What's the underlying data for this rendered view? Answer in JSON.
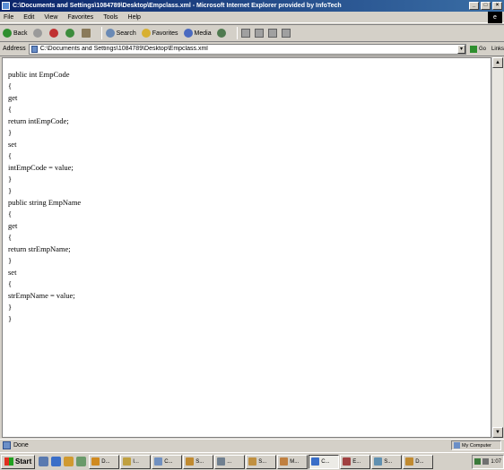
{
  "window": {
    "title": "C:\\Documents and Settings\\1084789\\Desktop\\Empclass.xml - Microsoft Internet Explorer provided by InfoTech"
  },
  "menubar": {
    "items": [
      "File",
      "Edit",
      "View",
      "Favorites",
      "Tools",
      "Help"
    ]
  },
  "toolbar": {
    "back_label": "Back",
    "search_label": "Search",
    "favorites_label": "Favorites",
    "media_label": "Media"
  },
  "address": {
    "label": "Address",
    "value": "C:\\Documents and Settings\\1084789\\Desktop\\Empclass.xml",
    "go_label": "Go",
    "links_label": "Links"
  },
  "content": {
    "lines": [
      "public int EmpCode",
      "{",
      "get",
      "{",
      "return intEmpCode;",
      "}",
      "set",
      "{",
      "intEmpCode = value;",
      "}",
      "}",
      "public string EmpName",
      "{",
      "get",
      "{",
      "return strEmpName;",
      "}",
      "set",
      "{",
      "strEmpName = value;",
      "}",
      "}"
    ]
  },
  "statusbar": {
    "status": "Done",
    "zone": "My Computer"
  },
  "taskbar": {
    "start_label": "Start",
    "buttons": [
      "D...",
      "I...",
      "C...",
      "S...",
      "...",
      "S...",
      "M...",
      "C...",
      "E...",
      "S...",
      "D..."
    ],
    "clock": "1:07"
  },
  "colors": {
    "titlebar_start": "#0a246a",
    "titlebar_end": "#3a6ea5",
    "chrome": "#d4d0c8"
  }
}
